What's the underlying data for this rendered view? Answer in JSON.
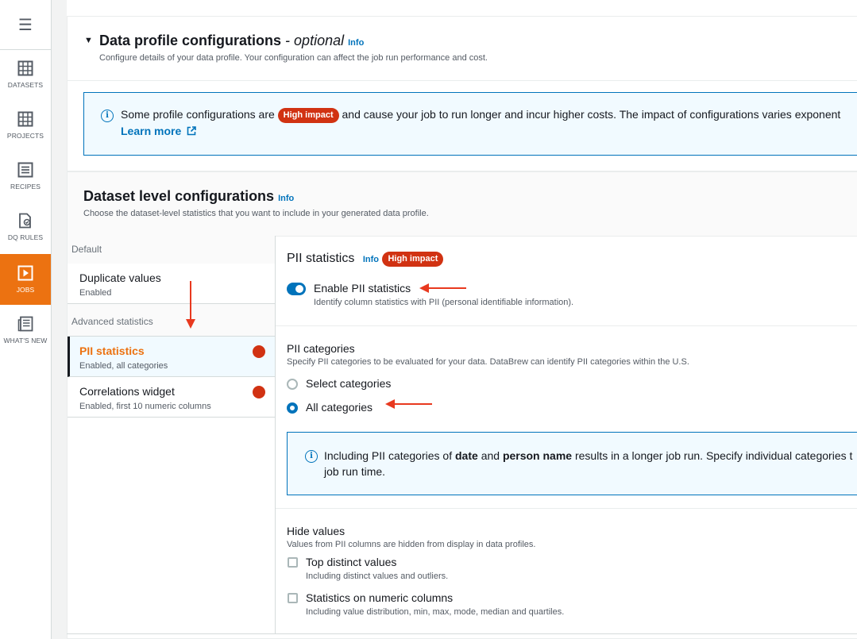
{
  "sidebar": {
    "menu_icon": "hamburger-menu-icon",
    "items": [
      {
        "label": "DATASETS",
        "icon": "datasets-grid-icon",
        "active": false
      },
      {
        "label": "PROJECTS",
        "icon": "projects-grid-icon",
        "active": false
      },
      {
        "label": "RECIPES",
        "icon": "recipes-list-icon",
        "active": false
      },
      {
        "label": "DQ RULES",
        "icon": "dq-rules-icon",
        "active": false
      },
      {
        "label": "JOBS",
        "icon": "jobs-play-icon",
        "active": true
      },
      {
        "label": "WHAT'S NEW",
        "icon": "whats-new-icon",
        "active": false
      }
    ]
  },
  "profile_config": {
    "title": "Data profile configurations",
    "optional_label": "- optional",
    "info_label": "Info",
    "description": "Configure details of your data profile. Your configuration can affect the job run performance and cost.",
    "alert": {
      "text_before": "Some profile configurations are",
      "badge": "High impact",
      "text_after": "and cause your job to run longer and incur higher costs. The impact of configurations varies exponent",
      "learn_more": "Learn more"
    }
  },
  "dataset_level": {
    "title": "Dataset level configurations",
    "info_label": "Info",
    "description": "Choose the dataset-level statistics that you want to include in your generated data profile.",
    "nav": {
      "default_section": "Default",
      "advanced_section": "Advanced statistics",
      "items": [
        {
          "title": "Duplicate values",
          "subtitle": "Enabled"
        },
        {
          "title": "PII statistics",
          "subtitle": "Enabled, all categories",
          "selected": true
        },
        {
          "title": "Correlations widget",
          "subtitle": "Enabled, first 10 numeric columns"
        }
      ]
    }
  },
  "pii": {
    "title": "PII statistics",
    "info_label": "Info",
    "badge": "High impact",
    "enable_label": "Enable PII statistics",
    "enable_desc": "Identify column statistics with PII (personal identifiable information).",
    "enabled": true,
    "categories_label": "PII categories",
    "categories_desc": "Specify PII categories to be evaluated for your data. DataBrew can identify PII categories within the U.S.",
    "options": [
      "Select categories",
      "All categories"
    ],
    "selected_option": "All categories",
    "alert": {
      "prefix": "Including PII categories of",
      "bold1": "date",
      "mid": "and",
      "bold2": "person name",
      "suffix": "results in a longer job run. Specify individual categories t",
      "line2": "job run time."
    },
    "hide_values_label": "Hide values",
    "hide_values_desc": "Values from PII columns are hidden from display in data profiles.",
    "checkboxes": [
      {
        "label": "Top distinct values",
        "desc": "Including distinct values and outliers.",
        "checked": false
      },
      {
        "label": "Statistics on numeric columns",
        "desc": "Including value distribution, min, max, mode, median and quartiles.",
        "checked": false
      }
    ]
  },
  "colors": {
    "accent": "#ec7211",
    "link": "#0073bb",
    "badge": "#d13212",
    "annotation_arrow": "#e8391f"
  }
}
